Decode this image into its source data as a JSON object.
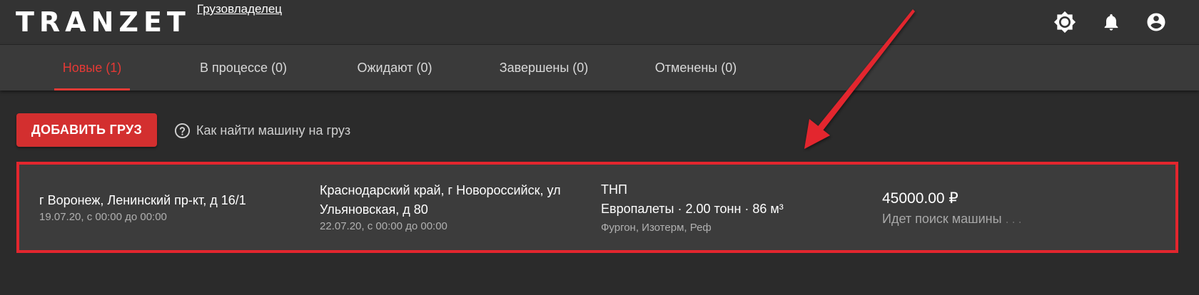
{
  "header": {
    "logo": "TRANZET",
    "role_link": "Грузовладелец",
    "icons": [
      "brightness-icon",
      "bell-icon",
      "account-icon"
    ]
  },
  "tabs": [
    {
      "label": "Новые (1)",
      "active": true
    },
    {
      "label": "В процессе (0)",
      "active": false
    },
    {
      "label": "Ожидают (0)",
      "active": false
    },
    {
      "label": "Завершены (0)",
      "active": false
    },
    {
      "label": "Отменены (0)",
      "active": false
    }
  ],
  "actions": {
    "add_cargo_label": "ДОБАВИТЬ ГРУЗ",
    "help_link_label": "Как найти машину на груз"
  },
  "cargo": {
    "origin_address": "г Воронеж, Ленинский пр-кт, д 16/1",
    "origin_time": "19.07.20, с 00:00 до 00:00",
    "destination_line1": "Краснодарский край, г Новороссийск, ул",
    "destination_line2": "Ульяновская, д 80",
    "destination_time": "22.07.20, с 00:00 до 00:00",
    "cargo_name": "ТНП",
    "cargo_details": "Европалеты · 2.00 тонн · 86 м³",
    "vehicle_types": "Фургон, Изотерм, Реф",
    "price": "45000.00 ₽",
    "status": "Идет поиск машины",
    "status_dots": "..."
  },
  "colors": {
    "accent": "#e53935",
    "highlight_border": "#e3262e",
    "background": "#2b2b2b",
    "topbar": "#333333",
    "card": "#3c3c3c"
  }
}
